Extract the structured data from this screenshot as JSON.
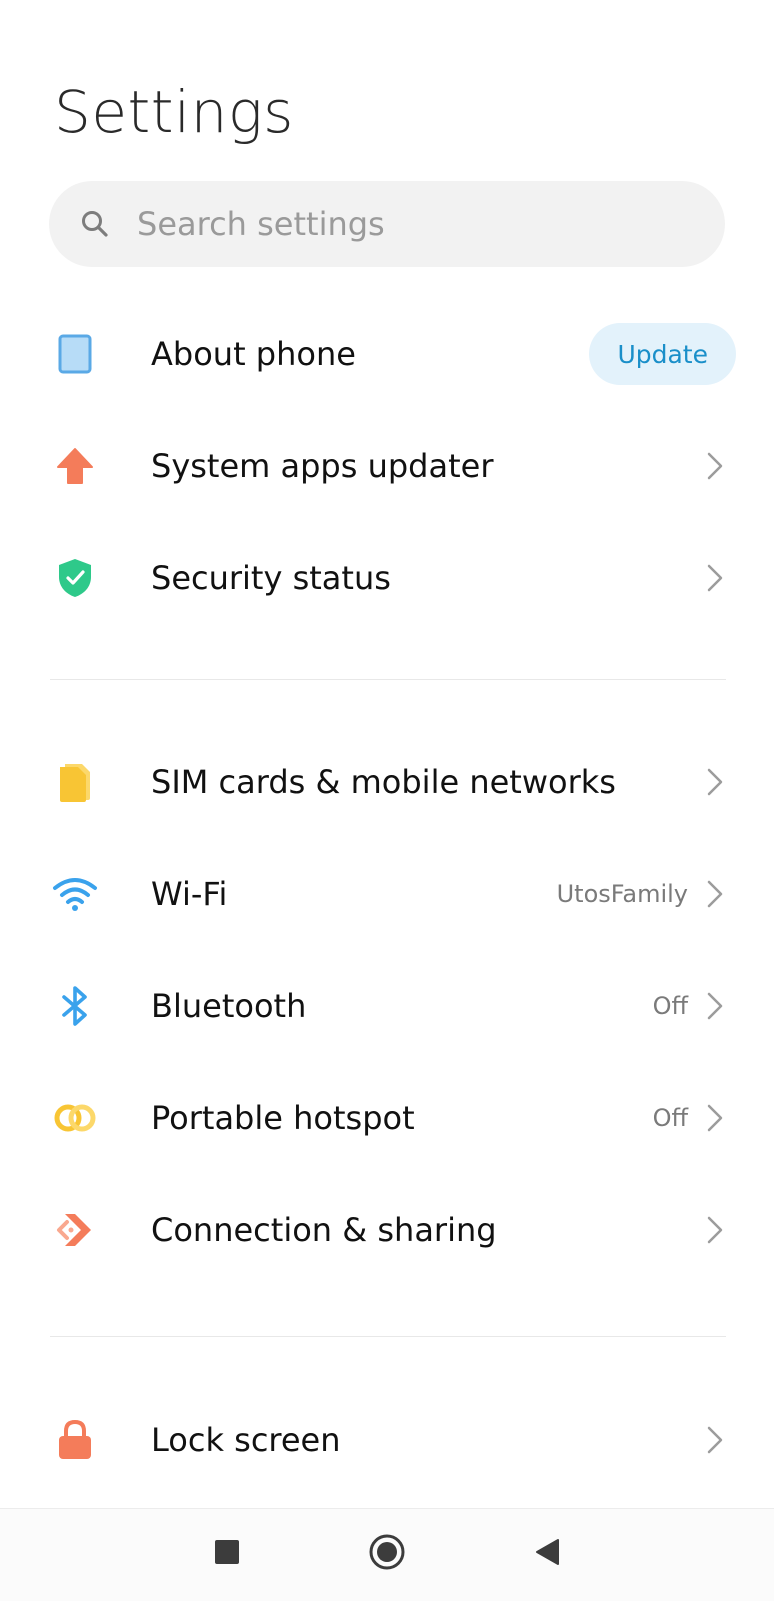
{
  "header": {
    "title": "Settings"
  },
  "search": {
    "placeholder": "Search settings",
    "icon": "search-icon"
  },
  "rows": [
    {
      "label": "About phone",
      "icon": "phone-icon",
      "icon_color": "#5aa9e6",
      "action_label": "Update"
    },
    {
      "label": "System apps updater",
      "icon": "arrow-up-icon",
      "icon_color": "#f47c5a"
    },
    {
      "label": "Security status",
      "icon": "shield-check-icon",
      "icon_color": "#2ec98a"
    },
    {
      "label": "SIM cards & mobile networks",
      "icon": "sim-card-icon",
      "icon_color": "#f8c534"
    },
    {
      "label": "Wi-Fi",
      "icon": "wifi-icon",
      "icon_color": "#3aa2ec",
      "value": "UtosFamily"
    },
    {
      "label": "Bluetooth",
      "icon": "bluetooth-icon",
      "icon_color": "#3aa2ec",
      "value": "Off"
    },
    {
      "label": "Portable hotspot",
      "icon": "hotspot-icon",
      "icon_color": "#f8c534",
      "value": "Off"
    },
    {
      "label": "Connection & sharing",
      "icon": "connection-icon",
      "icon_color": "#f47c5a"
    },
    {
      "label": "Lock screen",
      "icon": "lock-icon",
      "icon_color": "#f47c5a"
    }
  ],
  "navbar": {
    "items": [
      "recents-icon",
      "home-icon",
      "back-icon"
    ]
  },
  "colors": {
    "accent": "#1a8fc9",
    "update_bg": "#e3f2fb"
  }
}
